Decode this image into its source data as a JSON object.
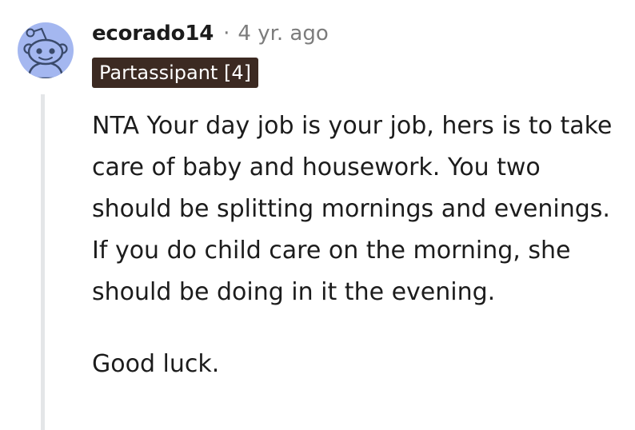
{
  "comment": {
    "author": "ecorado14",
    "separator": "·",
    "timestamp": "4 yr. ago",
    "flair": "Partassipant [4]",
    "avatar_icon": "reddit-snoo-avatar-icon",
    "colors": {
      "avatar_bg": "#a4b7f0",
      "flair_bg": "#3c2a22",
      "flair_text": "#ffffff",
      "meta_text": "#7c7c7c",
      "thread_line": "#e4e6e8"
    },
    "paragraphs": [
      "NTA Your day job is your job, hers is to take care of baby and housework. You two should be splitting mornings and evenings. If you do child care on the morning, she should be doing in it the evening.",
      "Good luck."
    ]
  }
}
